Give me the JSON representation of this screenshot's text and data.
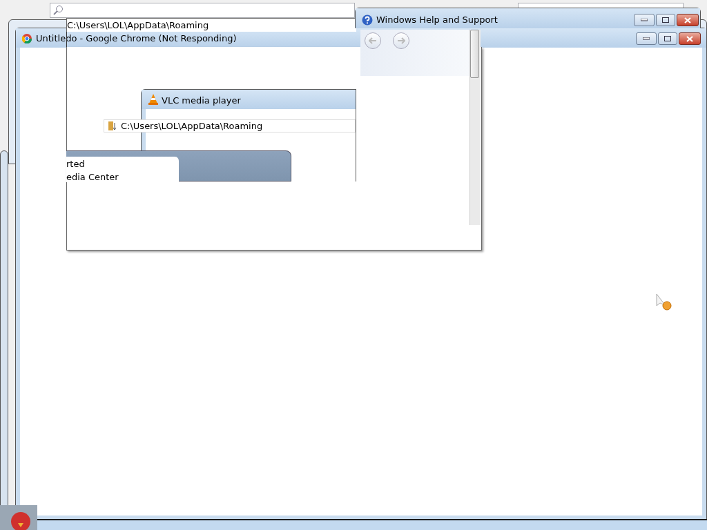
{
  "explorer_glitch": {
    "path": "C:\\Users\\LOL\\AppData\\Roaming"
  },
  "chrome_window": {
    "title": "Untitledo - Google Chrome (Not Responding)"
  },
  "vlc_window": {
    "title": "VLC media player",
    "path": "C:\\Users\\LOL\\AppData\\Roaming"
  },
  "start_panel": {
    "items": [
      "rted",
      "edia Center"
    ]
  },
  "help_window": {
    "title": "Windows Help and Support"
  }
}
